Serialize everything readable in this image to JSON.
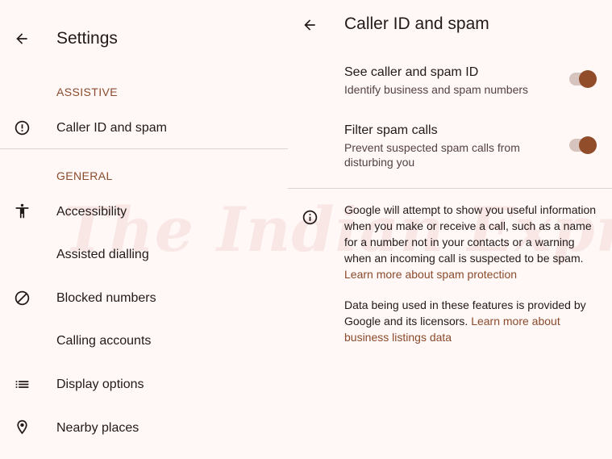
{
  "left": {
    "title": "Settings",
    "sections": [
      {
        "header": "ASSISTIVE",
        "items": [
          {
            "label": "Caller ID and spam",
            "icon": "alert-circle-icon"
          }
        ]
      },
      {
        "header": "GENERAL",
        "items": [
          {
            "label": "Accessibility",
            "icon": "accessibility-icon"
          },
          {
            "label": "Assisted dialling",
            "icon": ""
          },
          {
            "label": "Blocked numbers",
            "icon": "block-icon"
          },
          {
            "label": "Calling accounts",
            "icon": ""
          },
          {
            "label": "Display options",
            "icon": "list-icon"
          },
          {
            "label": "Nearby places",
            "icon": "location-pin-icon"
          }
        ]
      }
    ]
  },
  "right": {
    "title": "Caller ID and spam",
    "settings": [
      {
        "title": "See caller and spam ID",
        "subtitle": "Identify business and spam numbers",
        "enabled": true
      },
      {
        "title": "Filter spam calls",
        "subtitle": "Prevent suspected spam calls from disturbing you",
        "enabled": true
      }
    ],
    "info": {
      "paragraph1": "Google will attempt to show you useful information when you make or receive a call, such as a name for a number not in your contacts or a warning when an incoming call is suspected to be spam.",
      "link1": "Learn more about spam protection",
      "paragraph2": "Data being used in these features is provided by Google and its licensors.",
      "link2": "Learn more about business listings data"
    }
  },
  "watermark": "The Indian Express",
  "colors": {
    "background": "#FFF8F7",
    "accent": "#8B4A2B",
    "toggle_thumb": "#914D29",
    "toggle_track": "#D7C4BE",
    "divider": "#DCD2D0"
  }
}
